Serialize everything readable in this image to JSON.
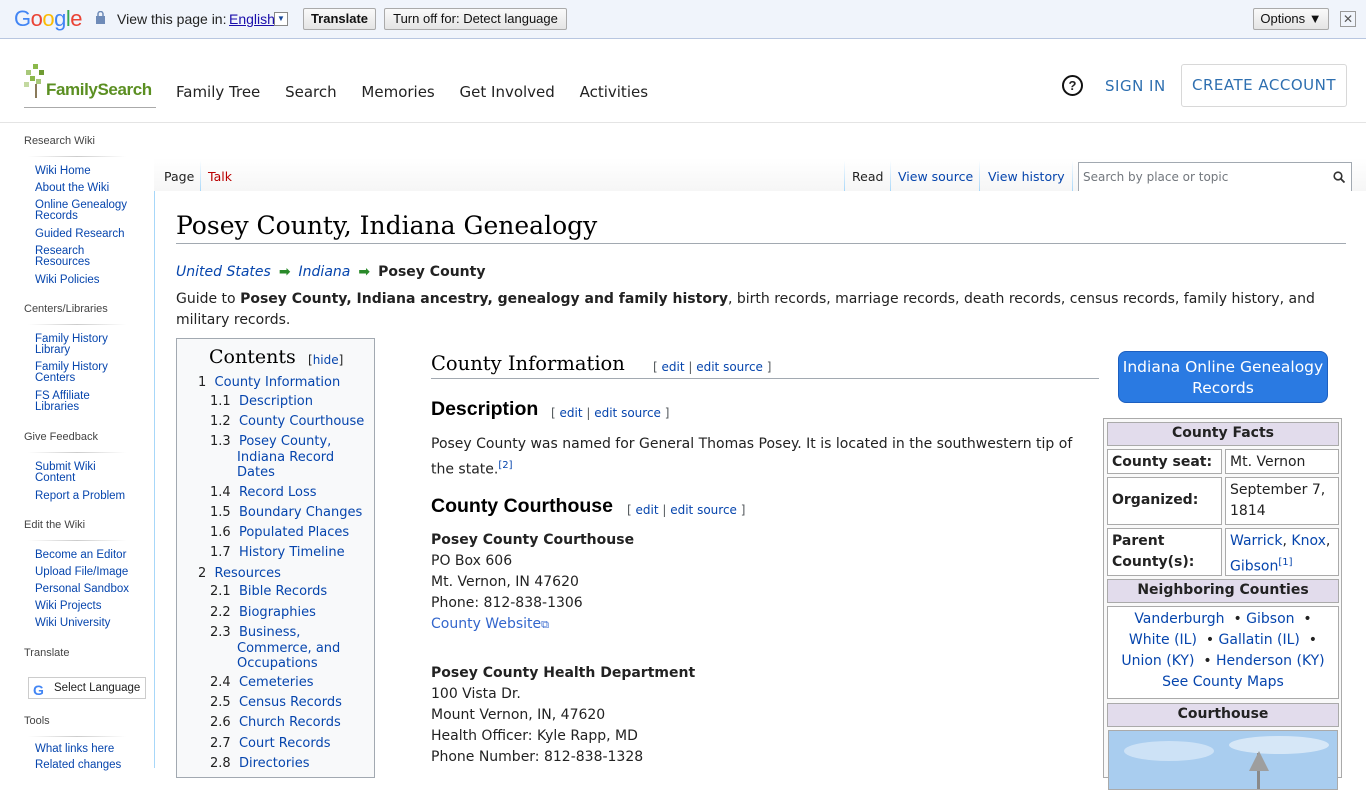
{
  "google_bar": {
    "logo": "Google",
    "view_page_in": "View this page in:",
    "language": "English",
    "translate_button": "Translate",
    "turn_off_button": "Turn off for: Detect language",
    "options_button": "Options ▼",
    "close": "✕"
  },
  "header": {
    "logo_text": "FamilySearch",
    "nav": [
      "Family Tree",
      "Search",
      "Memories",
      "Get Involved",
      "Activities"
    ],
    "help": "?",
    "sign_in": "SIGN IN",
    "create_account": "CREATE ACCOUNT"
  },
  "sidebar": {
    "sections": [
      {
        "title": "Research Wiki",
        "items": [
          "Wiki Home",
          "About the Wiki",
          "Online Genealogy Records",
          "Guided Research",
          "Research Resources",
          "Wiki Policies"
        ]
      },
      {
        "title": "Centers/Libraries",
        "items": [
          "Family History Library",
          "Family History Centers",
          "FS Affiliate Libraries"
        ]
      },
      {
        "title": "Give Feedback",
        "items": [
          "Submit Wiki Content",
          "Report a Problem"
        ]
      },
      {
        "title": "Edit the Wiki",
        "items": [
          "Become an Editor",
          "Upload File/Image",
          "Personal Sandbox",
          "Wiki Projects",
          "Wiki University"
        ]
      },
      {
        "title": "Translate",
        "items": []
      },
      {
        "title": "Tools",
        "items": [
          "What links here",
          "Related changes"
        ]
      }
    ],
    "select_language": "Select Language"
  },
  "tabs": {
    "page": "Page",
    "talk": "Talk",
    "read": "Read",
    "view_source": "View source",
    "view_history": "View history",
    "search_placeholder": "Search by place or topic"
  },
  "page": {
    "title": "Posey County, Indiana Genealogy",
    "breadcrumb": [
      "United States",
      "Indiana",
      "Posey County"
    ],
    "intro_prefix": "Guide to ",
    "intro_bold": "Posey County, Indiana ancestry, genealogy and family history",
    "intro_suffix": ", birth records, marriage records, death records, census records, family history, and military records."
  },
  "toc": {
    "title": "Contents",
    "hide_open": "[",
    "hide": "hide",
    "hide_close": "]",
    "items": [
      {
        "num": "1",
        "label": "County Information"
      },
      {
        "num": "1.1",
        "label": "Description"
      },
      {
        "num": "1.2",
        "label": "County Courthouse"
      },
      {
        "num": "1.3",
        "label": "Posey County, Indiana Record Dates"
      },
      {
        "num": "1.4",
        "label": "Record Loss"
      },
      {
        "num": "1.5",
        "label": "Boundary Changes"
      },
      {
        "num": "1.6",
        "label": "Populated Places"
      },
      {
        "num": "1.7",
        "label": "History Timeline"
      },
      {
        "num": "2",
        "label": "Resources"
      },
      {
        "num": "2.1",
        "label": "Bible Records"
      },
      {
        "num": "2.2",
        "label": "Biographies"
      },
      {
        "num": "2.3",
        "label": "Business, Commerce, and Occupations"
      },
      {
        "num": "2.4",
        "label": "Cemeteries"
      },
      {
        "num": "2.5",
        "label": "Census Records"
      },
      {
        "num": "2.6",
        "label": "Church Records"
      },
      {
        "num": "2.7",
        "label": "Court Records"
      },
      {
        "num": "2.8",
        "label": "Directories"
      }
    ]
  },
  "sections": {
    "county_info": "County Information",
    "description": "Description",
    "description_text": "Posey County was named for General Thomas Posey. It is located in the southwestern tip of the state.",
    "description_ref": "[2]",
    "courthouse": "County Courthouse",
    "edit": "edit",
    "edit_source": "edit source",
    "courthouse_name": "Posey County Courthouse",
    "courthouse_lines": [
      "PO Box 606",
      "Mt. Vernon, IN 47620",
      "Phone: 812-838-1306"
    ],
    "county_website": "County Website",
    "health_name": "Posey County Health Department",
    "health_lines": [
      "100 Vista Dr.",
      "Mount Vernon, IN, 47620",
      "Health Officer: Kyle Rapp, MD",
      "Phone Number: 812-838-1328"
    ]
  },
  "infobox": {
    "button": "Indiana Online Genealogy Records",
    "facts_title": "County Facts",
    "seat_label": "County seat:",
    "seat_value": "Mt. Vernon",
    "organized_label": "Organized:",
    "organized_value": "September 7, 1814",
    "parent_label": "Parent County(s):",
    "parent_values": [
      "Warrick",
      "Knox",
      "Gibson"
    ],
    "parent_ref": "[1]",
    "neighbors_title": "Neighboring Counties",
    "neighbors": [
      "Vanderburgh",
      "Gibson",
      "White (IL)",
      "Gallatin (IL)",
      "Union (KY)",
      "Henderson (KY)"
    ],
    "see_maps": "See County Maps",
    "courthouse_title": "Courthouse"
  },
  "colors": {
    "link": "#0645ad",
    "brand_green": "#5b8f22",
    "cta_blue": "#2a7ae2",
    "infobox_header": "#e2dcec"
  }
}
